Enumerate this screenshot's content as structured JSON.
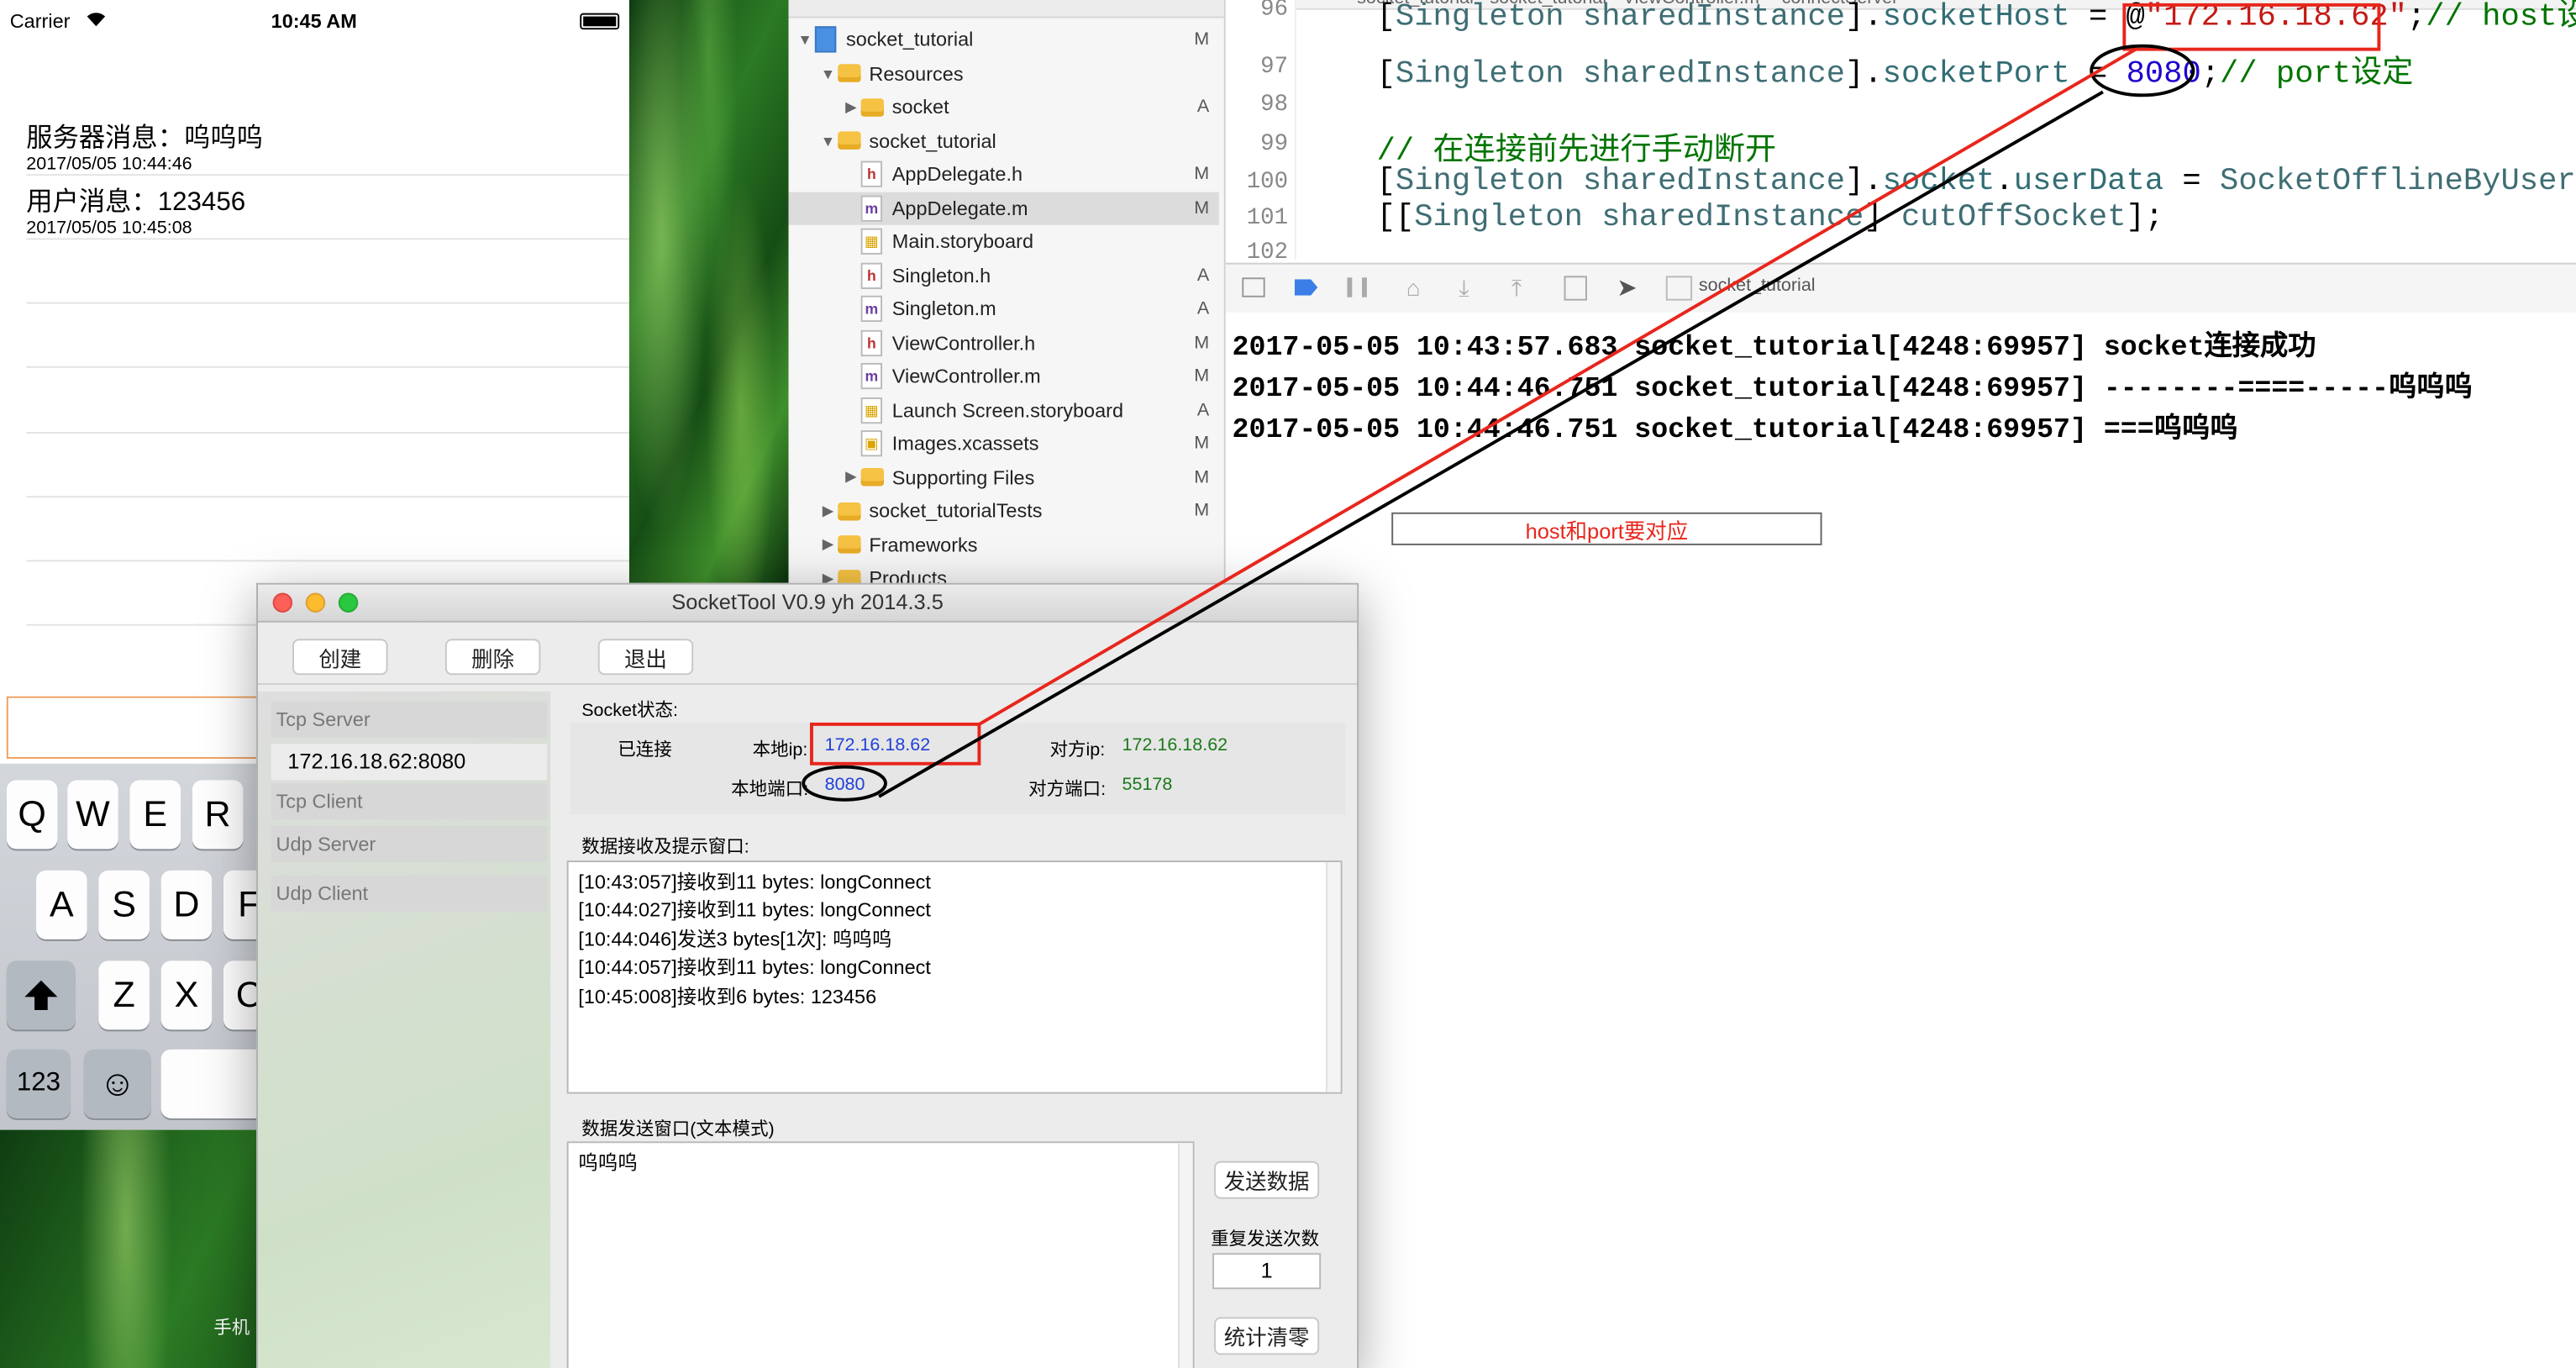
{
  "simulator": {
    "carrier": "Carrier",
    "time": "10:45 AM",
    "messages": [
      {
        "text": "服务器消息：呜呜呜",
        "time": "2017/05/05 10:44:46"
      },
      {
        "text": "用户消息：123456",
        "time": "2017/05/05 10:45:08"
      }
    ],
    "keyboard": {
      "row1": [
        "Q",
        "W",
        "E",
        "R"
      ],
      "row2": [
        "A",
        "S",
        "D",
        "F"
      ],
      "row3": [
        "Z",
        "X",
        "C"
      ],
      "numbers_key": "123",
      "emoji_glyph": "☺"
    },
    "bottom_caption": "手机"
  },
  "navigator": {
    "items": [
      {
        "label": "socket_tutorial",
        "badge": "M",
        "kind": "project",
        "indent": 0,
        "disclosure": "▼"
      },
      {
        "label": "Resources",
        "badge": "",
        "kind": "folder",
        "indent": 1,
        "disclosure": "▼"
      },
      {
        "label": "socket",
        "badge": "A",
        "kind": "folder",
        "indent": 2,
        "disclosure": "▶"
      },
      {
        "label": "socket_tutorial",
        "badge": "",
        "kind": "folder",
        "indent": 1,
        "disclosure": "▼"
      },
      {
        "label": "AppDelegate.h",
        "badge": "M",
        "kind": "h",
        "indent": 2,
        "disclosure": ""
      },
      {
        "label": "AppDelegate.m",
        "badge": "M",
        "kind": "m",
        "indent": 2,
        "disclosure": "",
        "selected": true
      },
      {
        "label": "Main.storyboard",
        "badge": "",
        "kind": "storyboard",
        "indent": 2,
        "disclosure": ""
      },
      {
        "label": "Singleton.h",
        "badge": "A",
        "kind": "h",
        "indent": 2,
        "disclosure": ""
      },
      {
        "label": "Singleton.m",
        "badge": "A",
        "kind": "m",
        "indent": 2,
        "disclosure": ""
      },
      {
        "label": "ViewController.h",
        "badge": "M",
        "kind": "h",
        "indent": 2,
        "disclosure": ""
      },
      {
        "label": "ViewController.m",
        "badge": "M",
        "kind": "m",
        "indent": 2,
        "disclosure": ""
      },
      {
        "label": "Launch Screen.storyboard",
        "badge": "A",
        "kind": "storyboard",
        "indent": 2,
        "disclosure": ""
      },
      {
        "label": "Images.xcassets",
        "badge": "M",
        "kind": "assets",
        "indent": 2,
        "disclosure": ""
      },
      {
        "label": "Supporting Files",
        "badge": "M",
        "kind": "folder",
        "indent": 2,
        "disclosure": "▶"
      },
      {
        "label": "socket_tutorialTests",
        "badge": "M",
        "kind": "folder",
        "indent": 1,
        "disclosure": "▶"
      },
      {
        "label": "Frameworks",
        "badge": "",
        "kind": "folder",
        "indent": 1,
        "disclosure": "▶"
      },
      {
        "label": "Products",
        "badge": "",
        "kind": "folder",
        "indent": 1,
        "disclosure": "▶"
      }
    ]
  },
  "editor": {
    "jumpbar": [
      "socket_tutorial",
      "socket_tutorial",
      "ViewController.m",
      "-connectServer"
    ],
    "lines": [
      {
        "num": "96",
        "parts": [
          [
            "[",
            "c-plain"
          ],
          [
            "Singleton",
            "c-obj"
          ],
          [
            " ",
            "c-plain"
          ],
          [
            "sharedInstance",
            "c-obj"
          ],
          [
            "].",
            "c-plain"
          ],
          [
            "socketHost",
            "c-prop"
          ],
          [
            " = @",
            "c-plain"
          ],
          [
            "\"172.16.18.62\"",
            "c-str"
          ],
          [
            ";",
            "c-plain"
          ],
          [
            "// host设定",
            "c-cmt"
          ]
        ]
      },
      {
        "num": "97",
        "parts": [
          [
            "[",
            "c-plain"
          ],
          [
            "Singleton",
            "c-obj"
          ],
          [
            " ",
            "c-plain"
          ],
          [
            "sharedInstance",
            "c-obj"
          ],
          [
            "].",
            "c-plain"
          ],
          [
            "socketPort",
            "c-prop"
          ],
          [
            " = ",
            "c-plain"
          ],
          [
            "8080",
            "c-num"
          ],
          [
            ";",
            "c-plain"
          ],
          [
            "// port设定",
            "c-cmt"
          ]
        ]
      },
      {
        "num": "98",
        "parts": []
      },
      {
        "num": "99",
        "parts": [
          [
            "// 在连接前先进行手动断开",
            "c-cmt"
          ]
        ]
      },
      {
        "num": "100",
        "parts": [
          [
            "[",
            "c-plain"
          ],
          [
            "Singleton",
            "c-obj"
          ],
          [
            " ",
            "c-plain"
          ],
          [
            "sharedInstance",
            "c-obj"
          ],
          [
            "].",
            "c-plain"
          ],
          [
            "socket",
            "c-prop"
          ],
          [
            ".",
            "c-plain"
          ],
          [
            "userData",
            "c-prop"
          ],
          [
            " = ",
            "c-plain"
          ],
          [
            "SocketOfflineByUser",
            "c-obj"
          ],
          [
            ";",
            "c-plain"
          ]
        ]
      },
      {
        "num": "101",
        "parts": [
          [
            "[[",
            "c-plain"
          ],
          [
            "Singleton",
            "c-obj"
          ],
          [
            " ",
            "c-plain"
          ],
          [
            "sharedInstance",
            "c-obj"
          ],
          [
            "] ",
            "c-plain"
          ],
          [
            "cutOffSocket",
            "c-obj"
          ],
          [
            "];",
            "c-plain"
          ]
        ]
      },
      {
        "num": "102",
        "parts": []
      }
    ],
    "debug_target": "socket_tutorial"
  },
  "console": {
    "lines": [
      "2017-05-05 10:43:57.683 socket_tutorial[4248:69957] socket连接成功",
      "2017-05-05 10:44:46.751 socket_tutorial[4248:69957] --------====-----呜呜呜",
      "2017-05-05 10:44:46.751 socket_tutorial[4248:69957] ===呜呜呜"
    ],
    "annotation": "host和port要对应"
  },
  "sockettool": {
    "title": "SocketTool V0.9 yh 2014.3.5",
    "toolbar": {
      "create": "创建",
      "delete": "删除",
      "exit": "退出"
    },
    "sidebar": {
      "tcp_server": "Tcp Server",
      "tcp_server_entry": "172.16.18.62:8080",
      "tcp_client": "Tcp Client",
      "udp_server": "Udp Server",
      "udp_client": "Udp Client"
    },
    "status": {
      "heading": "Socket状态:",
      "state": "已连接",
      "local_ip_label": "本地ip:",
      "local_ip": "172.16.18.62",
      "remote_ip_label": "对方ip:",
      "remote_ip": "172.16.18.62",
      "local_port_label": "本地端口:",
      "local_port": "8080",
      "remote_port_label": "对方端口:",
      "remote_port": "55178"
    },
    "receive": {
      "heading": "数据接收及提示窗口:",
      "log": [
        "[10:43:057]接收到11 bytes: longConnect",
        "[10:44:027]接收到11 bytes: longConnect",
        "[10:44:046]发送3 bytes[1次]: 呜呜呜",
        "[10:44:057]接收到11 bytes: longConnect",
        "[10:45:008]接收到6 bytes: 123456"
      ]
    },
    "send": {
      "heading": "数据发送窗口(文本模式)",
      "text": "呜呜呜",
      "send_button": "发送数据",
      "repeat_label": "重复发送次数",
      "repeat_value": "1",
      "clear_button": "统计清零"
    }
  },
  "colors": {
    "annotation_red": "#e8261c",
    "annotation_black": "#000000",
    "link_blue": "#2040d8",
    "remote_green": "#1a7a1a"
  }
}
